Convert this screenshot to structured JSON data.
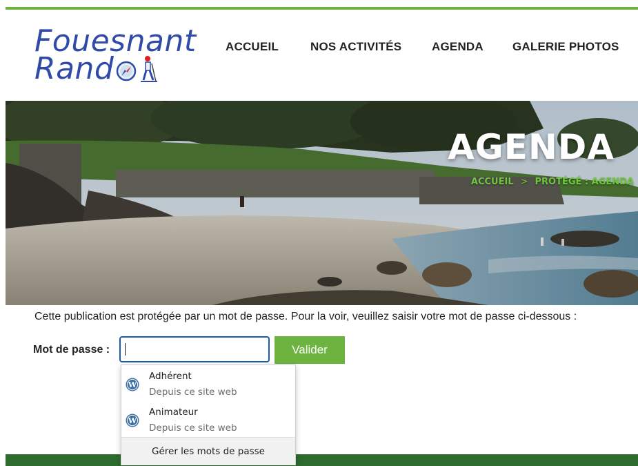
{
  "header": {
    "logo_line1": "Fouesnant",
    "logo_line2": "Rand",
    "nav": [
      "ACCUEIL",
      "NOS ACTIVITÉS",
      "AGENDA",
      "GALERIE PHOTOS"
    ]
  },
  "hero": {
    "title": "AGENDA",
    "breadcrumb": {
      "home": "ACCUEIL",
      "separator": ">",
      "current": "PROTÉGÉ : AGENDA"
    }
  },
  "content": {
    "notice": "Cette publication est protégée par un mot de passe. Pour la voir, veuillez saisir votre mot de passe ci-dessous :",
    "password_label": "Mot de passe :",
    "password_value": "",
    "submit_label": "Valider"
  },
  "autocomplete": {
    "items": [
      {
        "name": "Adhérent",
        "source": "Depuis ce site web",
        "icon": "wordpress-icon"
      },
      {
        "name": "Animateur",
        "source": "Depuis ce site web",
        "icon": "wordpress-icon"
      }
    ],
    "manage_label": "Gérer les mots de passe"
  },
  "colors": {
    "accent_green": "#6cb33f",
    "footer_green": "#2d6b2f",
    "logo_blue": "#2f4aa8",
    "input_focus": "#1f5aa8"
  }
}
